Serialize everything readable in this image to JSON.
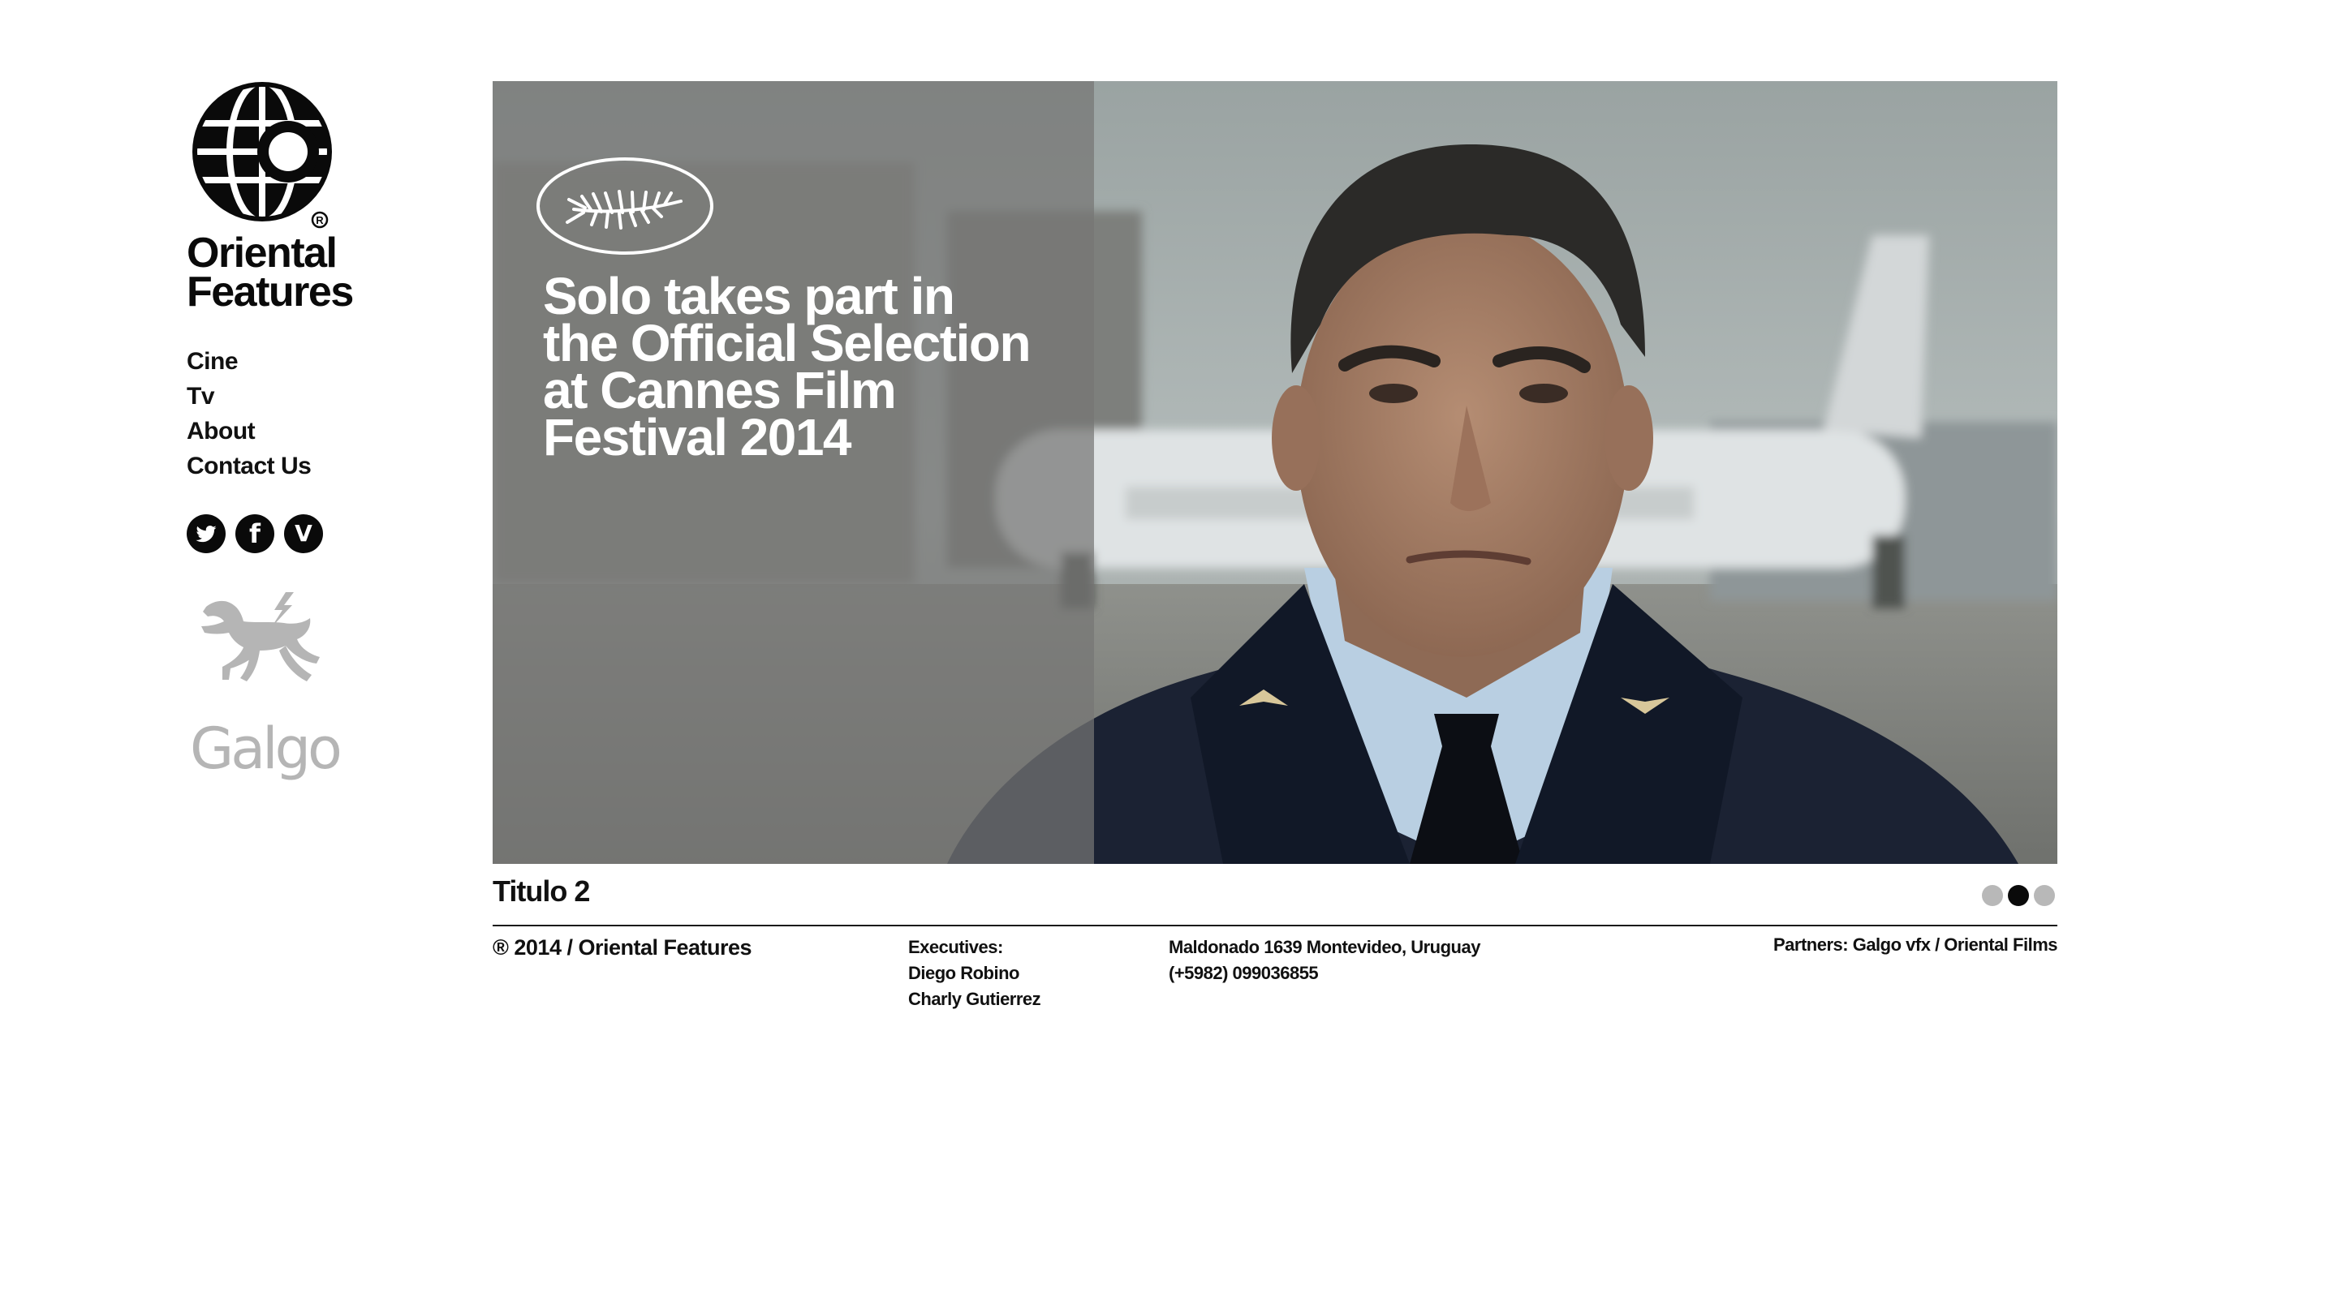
{
  "brand": {
    "name_line1": "Oriental",
    "name_line2": "Features",
    "registered_mark": "®"
  },
  "nav": [
    {
      "label": "Cine"
    },
    {
      "label": "Tv"
    },
    {
      "label": "About"
    },
    {
      "label": "Contact Us"
    }
  ],
  "social": [
    {
      "icon": "twitter-icon"
    },
    {
      "icon": "facebook-icon",
      "glyph": "f"
    },
    {
      "icon": "vimeo-icon",
      "glyph": "V"
    }
  ],
  "partner_logo": {
    "word": "Galgo",
    "icon": "galgo-horse-icon",
    "color": "#b5b5b5"
  },
  "slider": {
    "badge_icon": "cannes-palm-icon",
    "headline_lines": [
      "Solo takes part in",
      "the Official Selection",
      "at Cannes Film",
      "Festival 2014"
    ],
    "caption": "Titulo 2",
    "slide_count": 3,
    "active_slide": 2
  },
  "footer": {
    "copyright": "® 2014 / Oriental Features",
    "executives_label": "Executives:",
    "executives": [
      "Diego Robino",
      "Charly Gutierrez"
    ],
    "address": "Maldonado 1639 Montevideo, Uruguay",
    "phone": "(+5982) 099036855",
    "partners": "Partners: Galgo vfx / Oriental Films"
  },
  "colors": {
    "text": "#111111",
    "overlay": "#767674",
    "dot_inactive": "#b8b8b8",
    "dot_active": "#0a0a0a"
  }
}
